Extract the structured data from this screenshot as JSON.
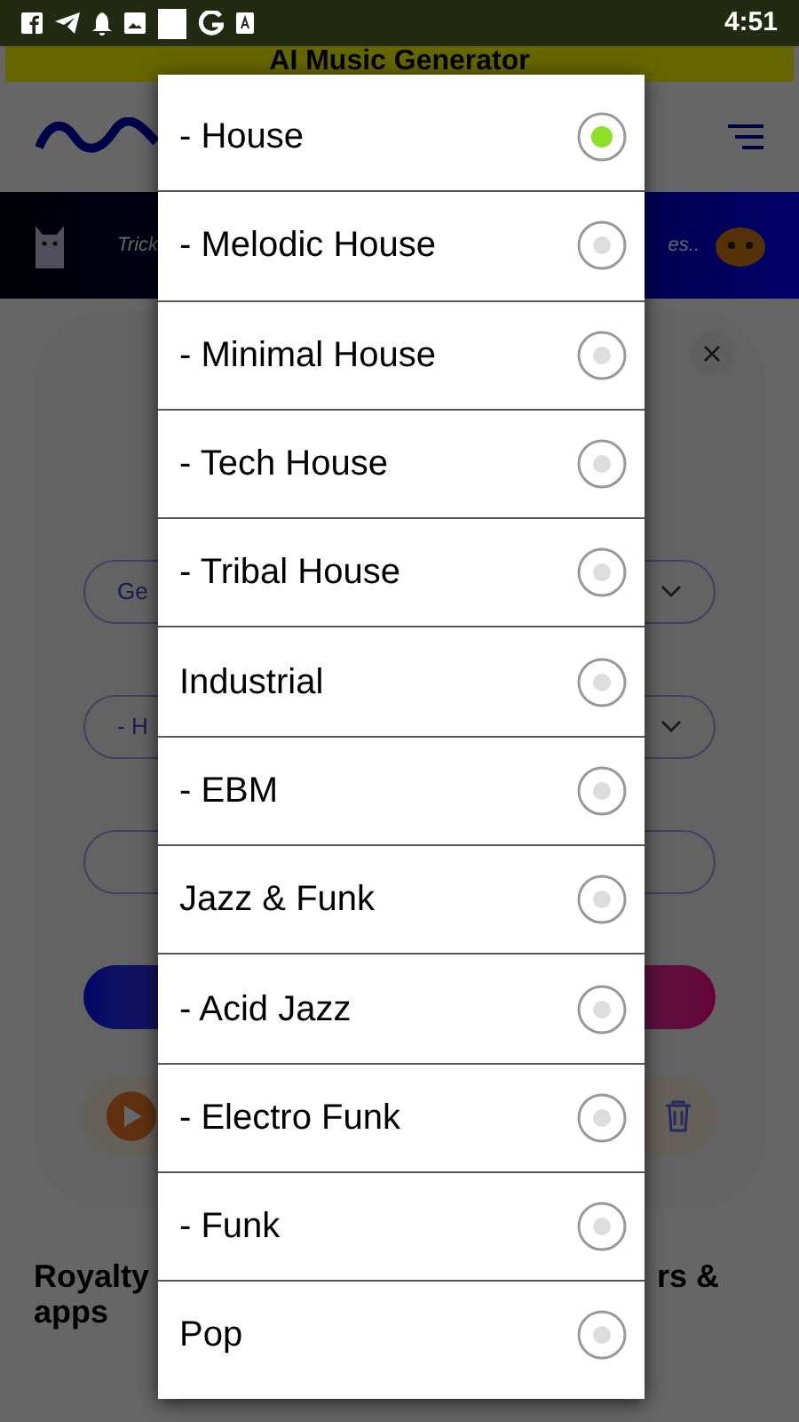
{
  "status_bar": {
    "time": "4:51"
  },
  "app_title": "AI Music Generator",
  "banner": {
    "text_left": "Trick",
    "text_right": "es.."
  },
  "form": {
    "fields": [
      {
        "kind": "select",
        "value": "Ge"
      },
      {
        "kind": "select",
        "value": "- H"
      },
      {
        "kind": "input"
      }
    ]
  },
  "heading": {
    "left": "Royalty",
    "right": "rs &",
    "line_2": "apps"
  },
  "dialog": {
    "options": [
      {
        "label": "- House",
        "selected": true
      },
      {
        "label": "- Melodic House",
        "selected": false
      },
      {
        "label": "- Minimal House",
        "selected": false
      },
      {
        "label": "- Tech House",
        "selected": false
      },
      {
        "label": "- Tribal House",
        "selected": false
      },
      {
        "label": "Industrial",
        "selected": false
      },
      {
        "label": "- EBM",
        "selected": false
      },
      {
        "label": "Jazz & Funk",
        "selected": false
      },
      {
        "label": "- Acid Jazz",
        "selected": false
      },
      {
        "label": "- Electro Funk",
        "selected": false
      },
      {
        "label": "- Funk",
        "selected": false
      },
      {
        "label": "Pop",
        "selected": false
      }
    ]
  }
}
